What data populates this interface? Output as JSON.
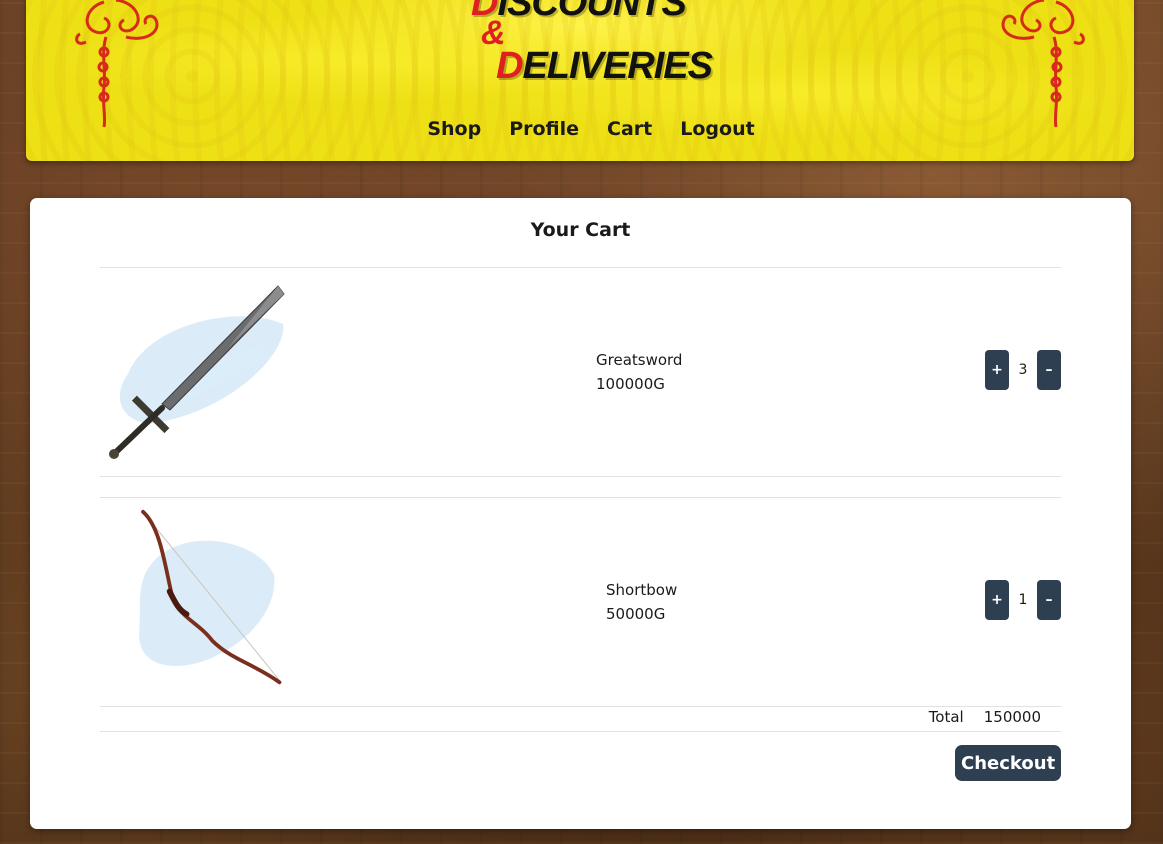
{
  "header": {
    "logo": {
      "line1_initial": "D",
      "line1_rest": "ISCOUNTS",
      "ampersand": "&",
      "line2_initial": "D",
      "line2_rest": "ELIVERIES"
    },
    "nav": [
      {
        "label": "Shop"
      },
      {
        "label": "Profile"
      },
      {
        "label": "Cart"
      },
      {
        "label": "Logout"
      }
    ]
  },
  "cart": {
    "title": "Your Cart",
    "items": [
      {
        "name": "Greatsword",
        "price": "100000G",
        "quantity": "3",
        "image": "greatsword-image",
        "plus": "+",
        "minus": "–"
      },
      {
        "name": "Shortbow",
        "price": "50000G",
        "quantity": "1",
        "image": "shortbow-image",
        "plus": "+",
        "minus": "–"
      }
    ],
    "total_label": "Total",
    "total_value": "150000",
    "checkout_label": "Checkout"
  },
  "colors": {
    "banner_yellow": "#ede015",
    "logo_red": "#e02020",
    "button_navy": "#2e3f52"
  }
}
